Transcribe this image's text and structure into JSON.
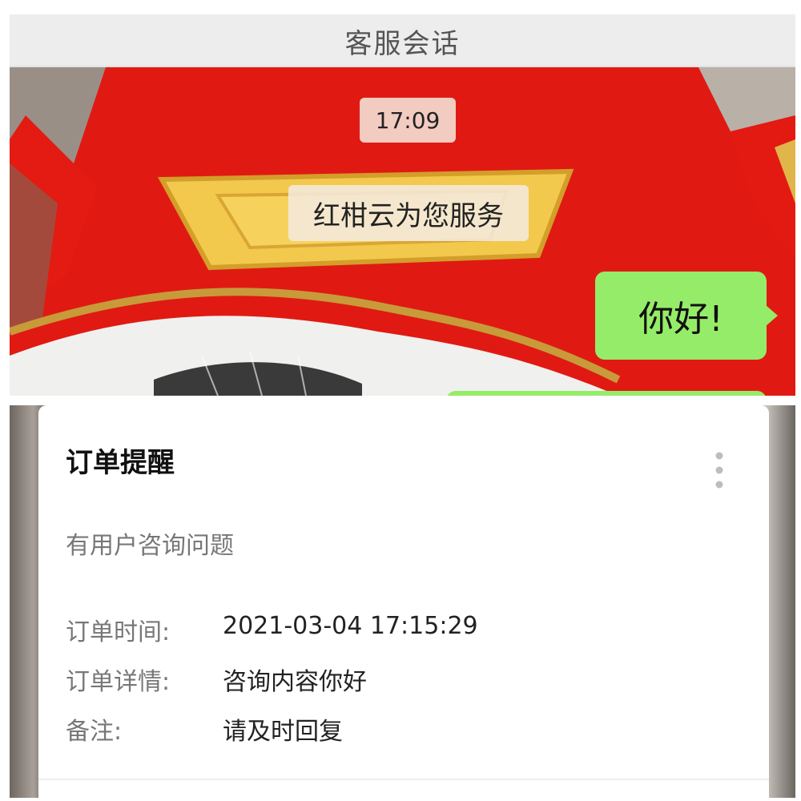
{
  "header": {
    "title": "客服会话"
  },
  "chat": {
    "timestamp": "17:09",
    "system_message": "红柑云为您服务",
    "user_message": "你好!"
  },
  "order_card": {
    "title": "订单提醒",
    "more_icon": "more-vertical-icon",
    "subtitle": "有用户咨询问题",
    "fields": [
      {
        "label": "订单时间:",
        "value": "2021-03-04 17:15:29"
      },
      {
        "label": "订单详情:",
        "value": "咨询内容你好"
      },
      {
        "label": "备注:",
        "value": "请及时回复"
      }
    ]
  },
  "colors": {
    "bubble_green": "#95ec69",
    "header_bg": "#ededed",
    "background_red": "#e31811"
  }
}
